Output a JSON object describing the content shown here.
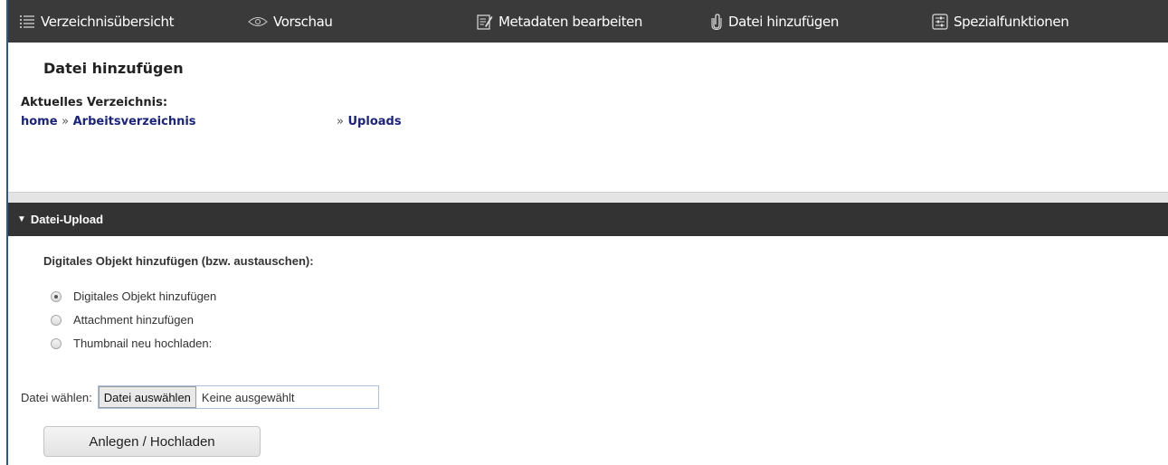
{
  "toolbar": {
    "items": [
      {
        "label": "Verzeichnisübersicht",
        "icon": "list-icon"
      },
      {
        "label": "Vorschau",
        "icon": "eye-icon"
      },
      {
        "label": "Metadaten bearbeiten",
        "icon": "edit-icon"
      },
      {
        "label": "Datei hinzufügen",
        "icon": "paperclip-icon"
      },
      {
        "label": "Spezialfunktionen",
        "icon": "sliders-icon"
      }
    ]
  },
  "header": {
    "title": "Datei hinzufügen",
    "current_dir_label": "Aktuelles Verzeichnis:",
    "breadcrumb": {
      "home": "home",
      "sep1": "»",
      "work": "Arbeitsverzeichnis",
      "sep2": "»",
      "uploads": "Uploads"
    }
  },
  "panel": {
    "title": "Datei-Upload",
    "section_label": "Digitales Objekt hinzufügen (bzw. austauschen):",
    "options": [
      {
        "label": "Digitales Objekt hinzufügen",
        "checked": true
      },
      {
        "label": "Attachment hinzufügen",
        "checked": false
      },
      {
        "label": "Thumbnail neu hochladen:",
        "checked": false
      }
    ],
    "file_label": "Datei wählen:",
    "file_button": "Datei auswählen",
    "file_status": "Keine ausgewählt",
    "submit": "Anlegen / Hochladen"
  },
  "colors": {
    "toolbar_bg": "#3a3a3a",
    "panel_head_bg": "#333333",
    "link": "#1a237e",
    "frame_border": "#2b5797"
  }
}
